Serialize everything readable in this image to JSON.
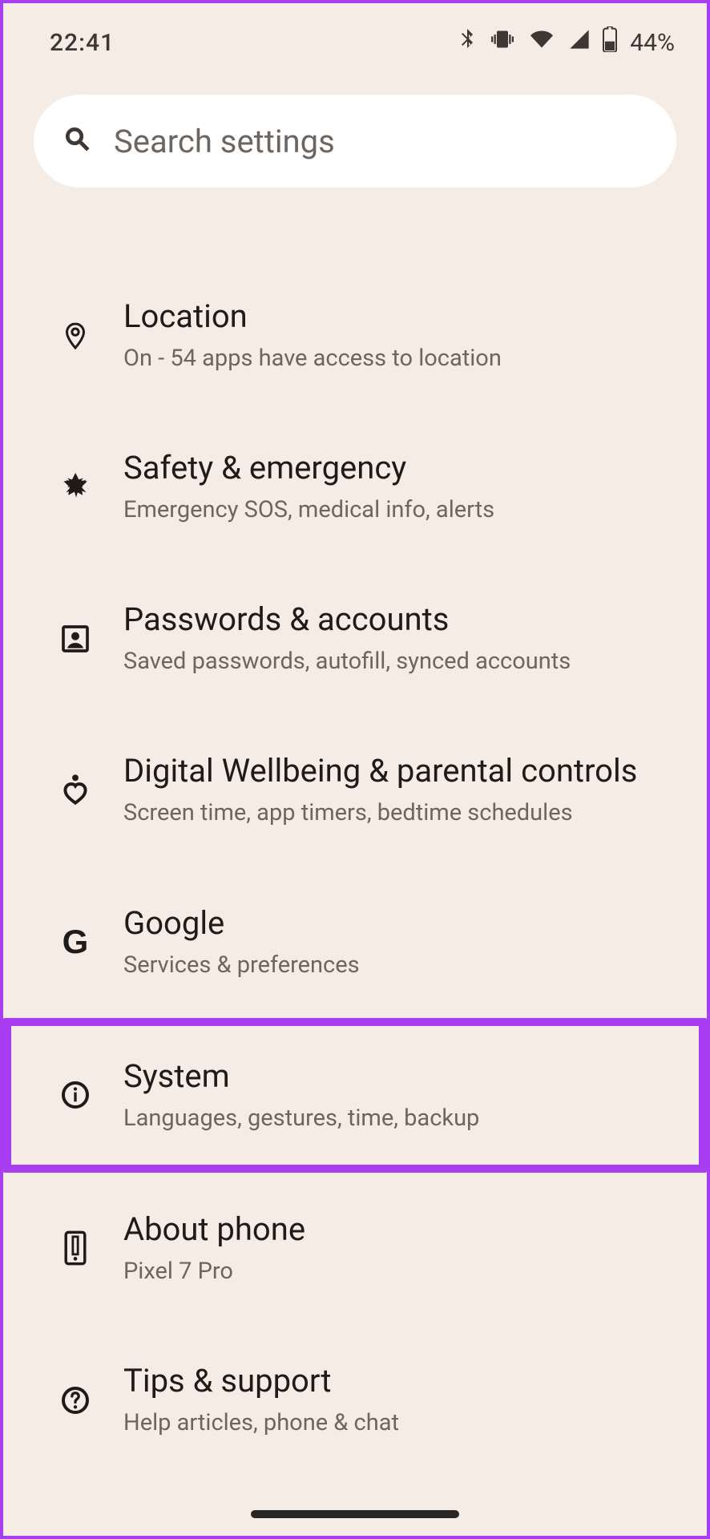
{
  "status": {
    "time": "22:41",
    "battery": "44%"
  },
  "search": {
    "placeholder": "Search settings"
  },
  "items": [
    {
      "title": "Location",
      "subtitle": "On - 54 apps have access to location"
    },
    {
      "title": "Safety & emergency",
      "subtitle": "Emergency SOS, medical info, alerts"
    },
    {
      "title": "Passwords & accounts",
      "subtitle": "Saved passwords, autofill, synced accounts"
    },
    {
      "title": "Digital Wellbeing & parental controls",
      "subtitle": "Screen time, app timers, bedtime schedules"
    },
    {
      "title": "Google",
      "subtitle": "Services & preferences"
    },
    {
      "title": "System",
      "subtitle": "Languages, gestures, time, backup"
    },
    {
      "title": "About phone",
      "subtitle": "Pixel 7 Pro"
    },
    {
      "title": "Tips & support",
      "subtitle": "Help articles, phone & chat"
    }
  ]
}
